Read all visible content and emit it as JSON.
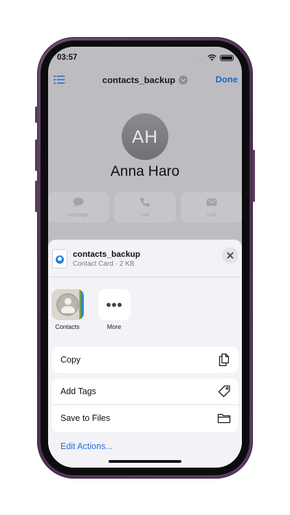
{
  "status_bar": {
    "time": "03:57",
    "signal": "....",
    "wifi_icon": "wifi-icon",
    "battery_icon": "battery-icon"
  },
  "nav": {
    "title": "contacts_backup",
    "done_label": "Done",
    "list_icon": "list-icon",
    "chevron_icon": "chevron-down-icon"
  },
  "contact": {
    "initials": "AH",
    "name": "Anna Haro",
    "actions": [
      {
        "label": "message",
        "icon": "message-icon"
      },
      {
        "label": "call",
        "icon": "phone-icon"
      },
      {
        "label": "mail",
        "icon": "mail-icon"
      }
    ]
  },
  "share_sheet": {
    "title": "contacts_backup",
    "subtitle": "Contact Card · 2 KB",
    "file_icon": "contact-file-icon",
    "close_icon": "close-icon",
    "apps": [
      {
        "label": "Contacts",
        "icon": "contacts-app-icon"
      },
      {
        "label": "More",
        "icon": "more-icon"
      }
    ],
    "actions": {
      "copy": {
        "label": "Copy",
        "icon": "copy-icon"
      },
      "add_tags": {
        "label": "Add Tags",
        "icon": "tag-icon"
      },
      "save_to_files": {
        "label": "Save to Files",
        "icon": "folder-icon"
      }
    },
    "edit_actions_label": "Edit Actions..."
  },
  "colors": {
    "frame": "#5e3b62",
    "accent_blue": "#1f66c7",
    "sheet_bg": "#f2f2f7",
    "dimmed_bg": "#bdbdc1"
  }
}
